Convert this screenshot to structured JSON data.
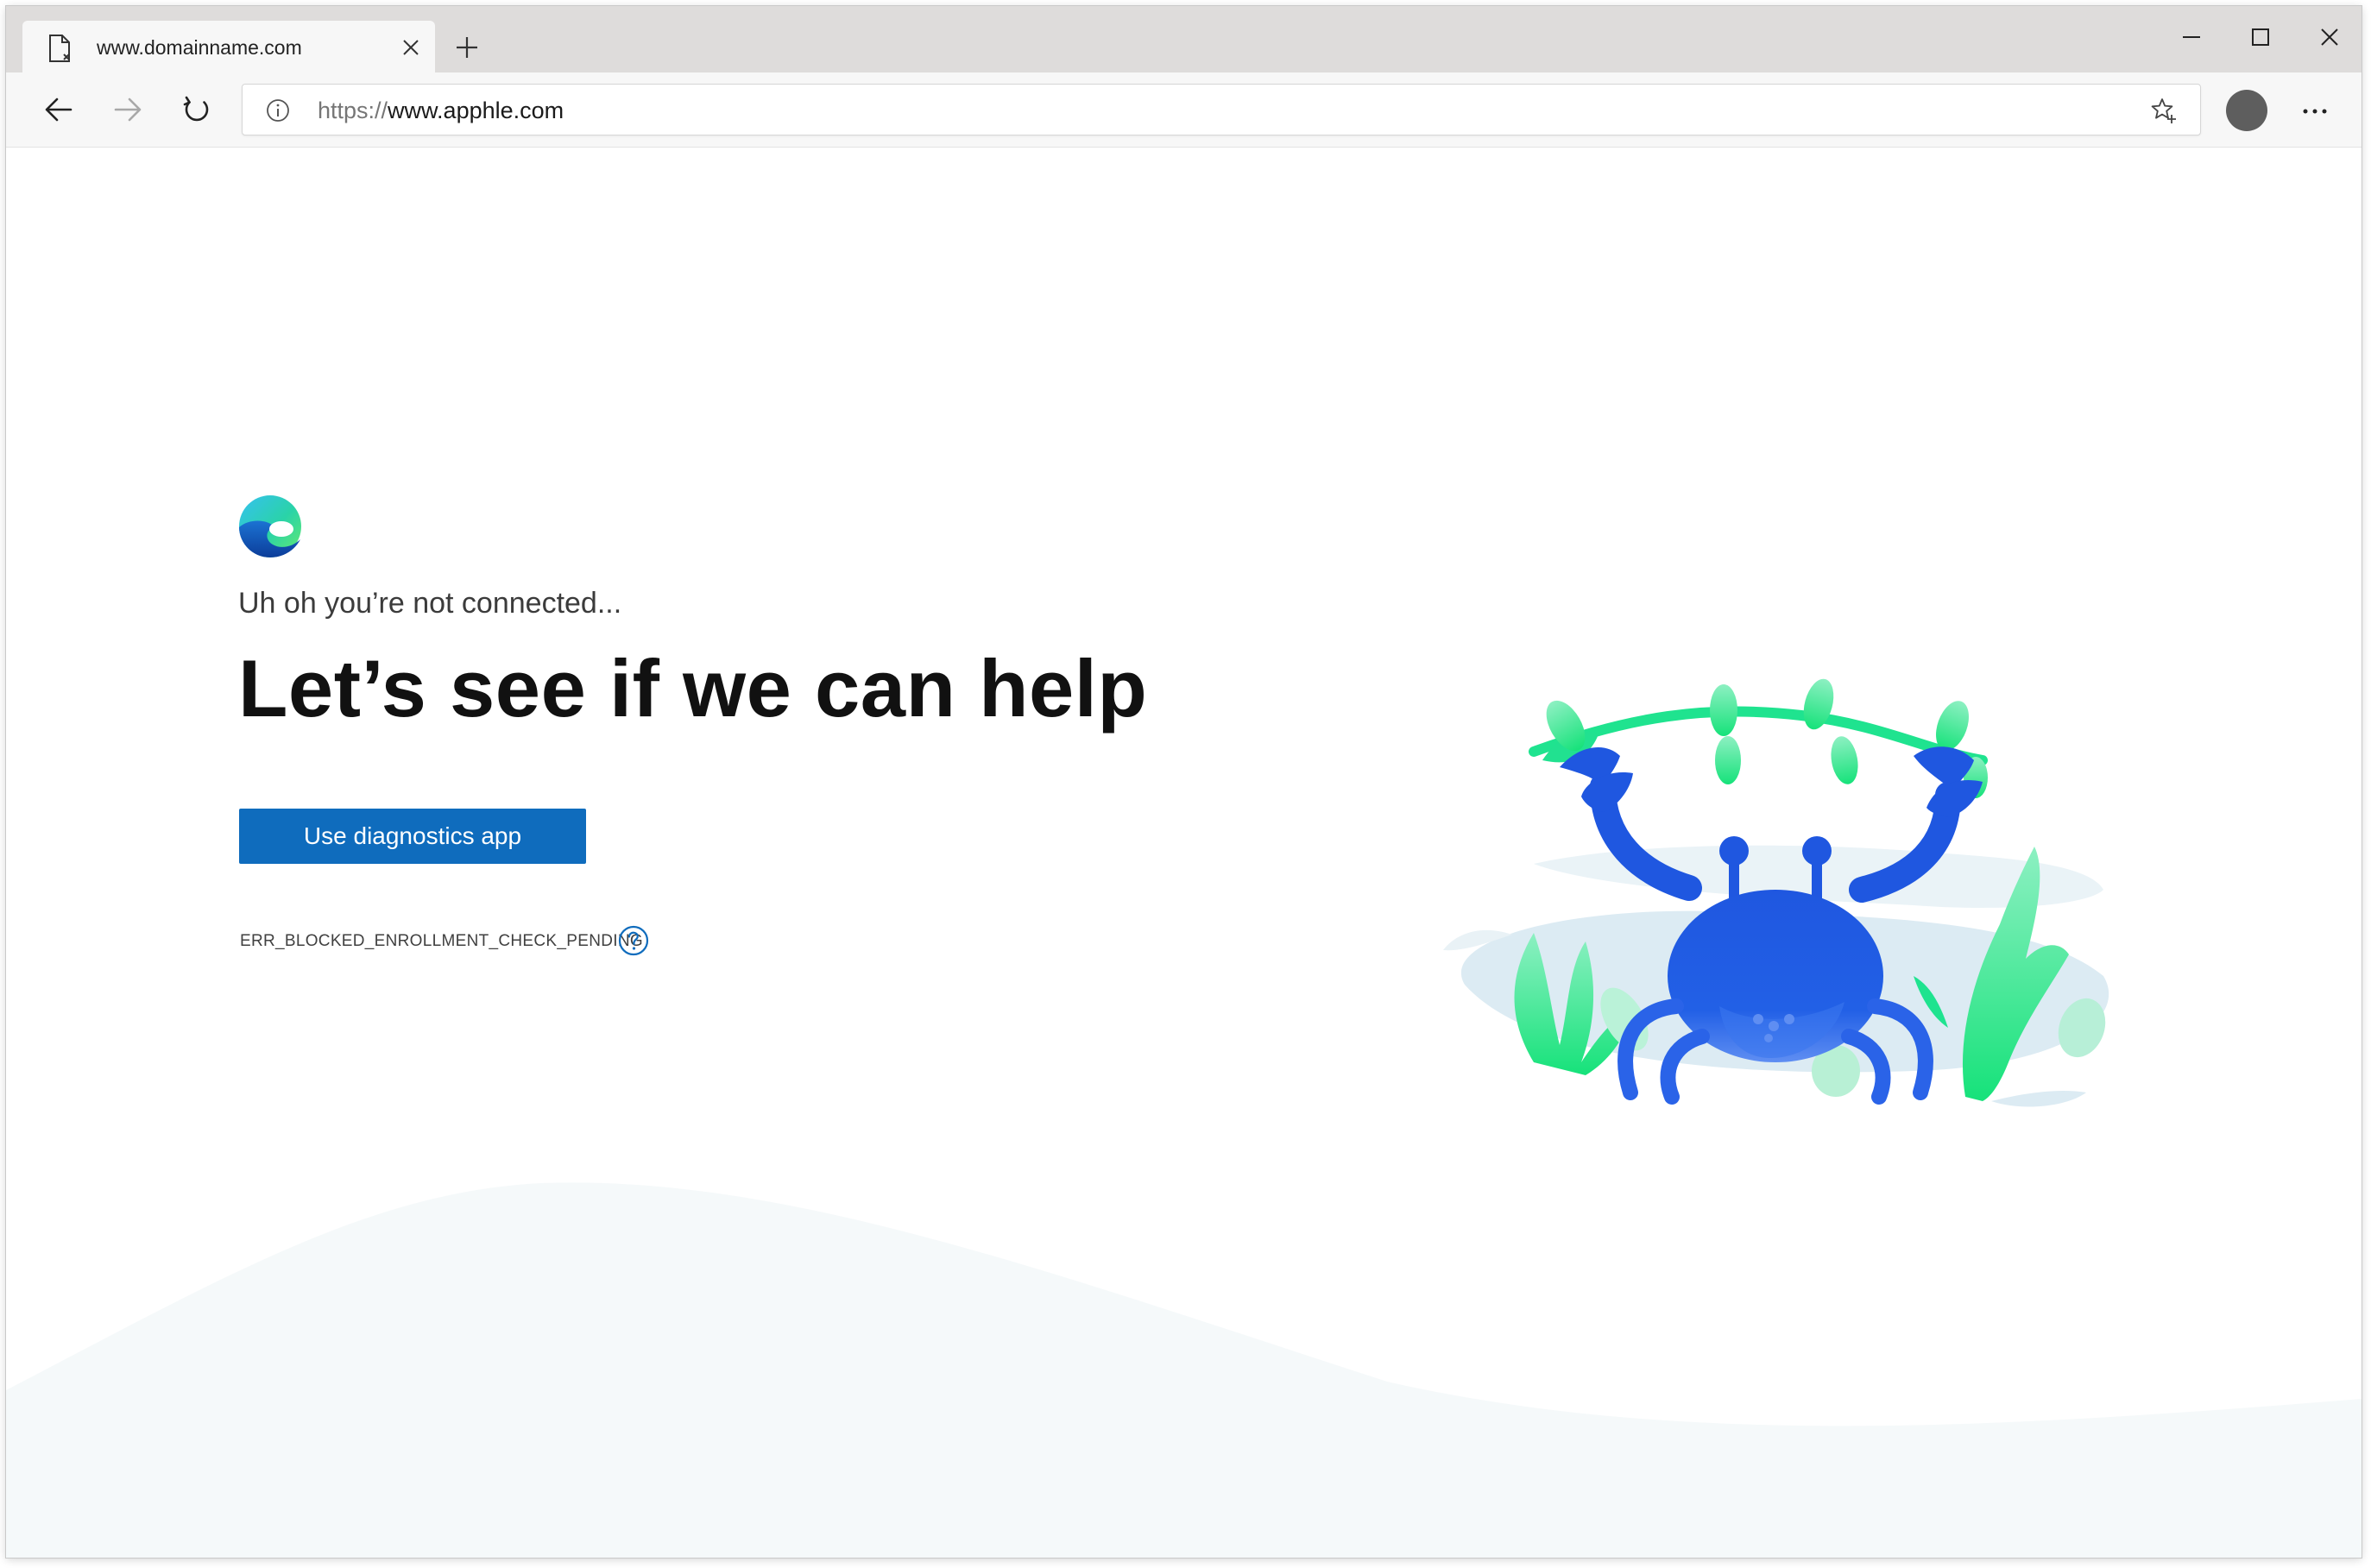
{
  "browser": {
    "tab": {
      "title": "www.domainname.com"
    },
    "address_bar": {
      "scheme": "https://",
      "host": "www.apphle.com"
    }
  },
  "page": {
    "subtitle": "Uh oh you’re not connected...",
    "headline": "Let’s see if we can help",
    "diagnostics_button": "Use diagnostics app",
    "error_code": "ERR_BLOCKED_ENROLLMENT_CHECK_PENDING"
  },
  "icons": {
    "tab_favicon": "page-broken-icon",
    "tab_close": "close-icon",
    "new_tab": "plus-icon",
    "minimize": "minimize-icon",
    "maximize": "maximize-icon",
    "close_window": "close-icon",
    "back": "arrow-left-icon",
    "forward": "arrow-right-icon",
    "refresh": "refresh-icon",
    "site_info": "info-icon",
    "favorite": "star-plus-icon",
    "profile": "avatar",
    "settings_more": "more-horizontal-icon",
    "brand": "edge-logo-icon",
    "help": "question-circle-icon"
  },
  "colors": {
    "accent_button": "#0f6cbd",
    "tabstrip": "#dedcdb",
    "toolbar": "#f7f7f7",
    "crab": "#1f57e0",
    "seaweed": "#1fe38f",
    "wave_background": "#f5f9fa"
  }
}
